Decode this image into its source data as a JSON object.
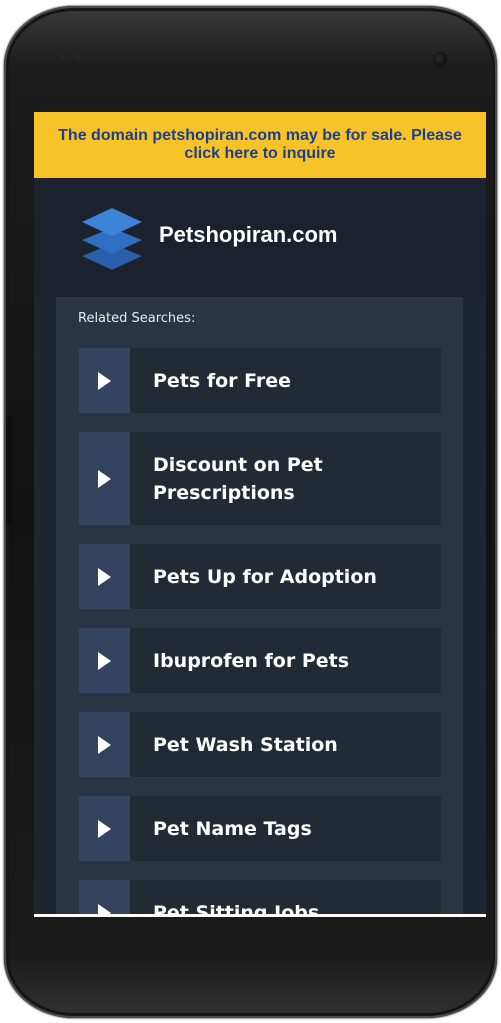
{
  "banner": {
    "text": "The domain petshopiran.com may be for sale. Please click here to inquire"
  },
  "header": {
    "site_name": "Petshopiran.com",
    "logo_icon": "stacked-layers-icon"
  },
  "related": {
    "label": "Related Searches:",
    "items": [
      {
        "label": "Pets for Free"
      },
      {
        "label": "Discount on Pet Prescriptions"
      },
      {
        "label": "Pets Up for Adoption"
      },
      {
        "label": "Ibuprofen for Pets"
      },
      {
        "label": "Pet Wash Station"
      },
      {
        "label": "Pet Name Tags"
      },
      {
        "label": "Pet Sitting Jobs"
      }
    ]
  },
  "colors": {
    "banner_bg": "#f7c329",
    "banner_text": "#1c3f8e",
    "screen_bg": "#1d2530",
    "item_bg": "#222a35",
    "arrow_box_bg": "#34445e",
    "logo_blue": "#2f6fc2"
  }
}
